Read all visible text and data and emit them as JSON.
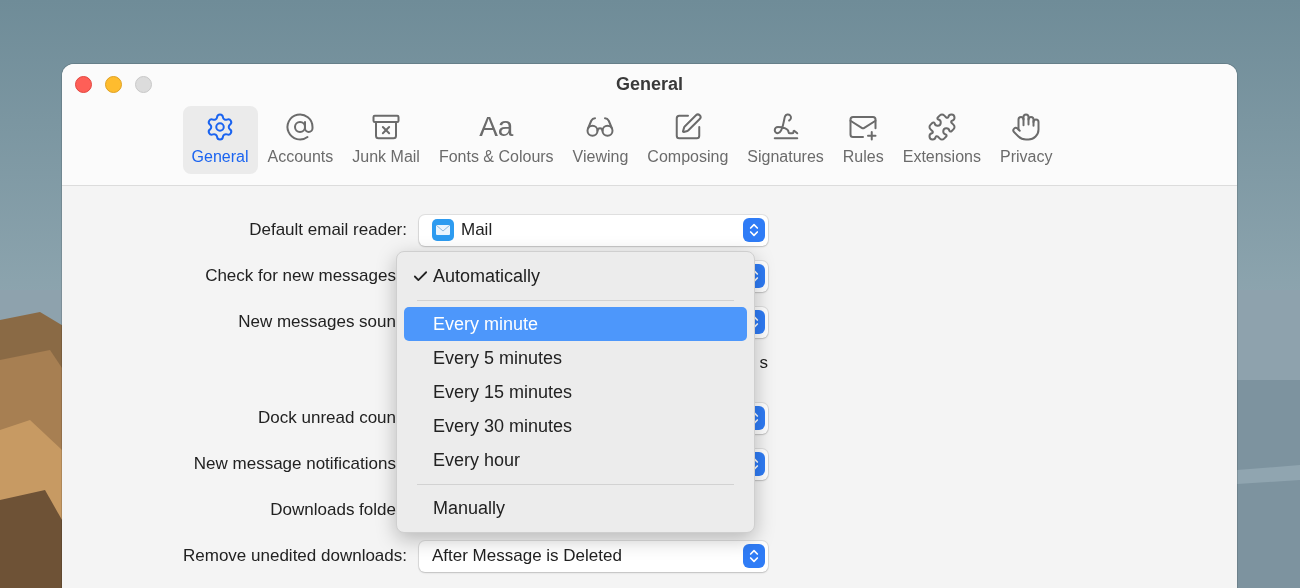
{
  "window": {
    "title": "General"
  },
  "toolbar": [
    {
      "label": "General",
      "selected": true
    },
    {
      "label": "Accounts",
      "selected": false
    },
    {
      "label": "Junk Mail",
      "selected": false
    },
    {
      "label": "Fonts & Colours",
      "glyph": "Aa",
      "selected": false
    },
    {
      "label": "Viewing",
      "selected": false
    },
    {
      "label": "Composing",
      "selected": false
    },
    {
      "label": "Signatures",
      "selected": false
    },
    {
      "label": "Rules",
      "selected": false
    },
    {
      "label": "Extensions",
      "selected": false
    },
    {
      "label": "Privacy",
      "selected": false
    }
  ],
  "rows": [
    {
      "kind": "app_select",
      "label": "Default email reader:",
      "value": "Mail"
    },
    {
      "kind": "covered_select",
      "label": "Check for new messages"
    },
    {
      "kind": "covered_select",
      "label": "New messages soun"
    },
    {
      "kind": "fragment",
      "text": "s"
    },
    {
      "kind": "covered_select",
      "label": "Dock unread coun"
    },
    {
      "kind": "covered_select",
      "label": "New message notifications"
    },
    {
      "kind": "covered",
      "label": "Downloads folde"
    },
    {
      "kind": "select",
      "label": "Remove unedited downloads:",
      "value": "After Message is Deleted"
    }
  ],
  "menu": [
    {
      "kind": "item",
      "label": "Automatically",
      "checked": true,
      "selected": false
    },
    {
      "kind": "separator"
    },
    {
      "kind": "item",
      "label": "Every minute",
      "checked": false,
      "selected": true
    },
    {
      "kind": "item",
      "label": "Every 5 minutes",
      "checked": false,
      "selected": false
    },
    {
      "kind": "item",
      "label": "Every 15 minutes",
      "checked": false,
      "selected": false
    },
    {
      "kind": "item",
      "label": "Every 30 minutes",
      "checked": false,
      "selected": false
    },
    {
      "kind": "item",
      "label": "Every hour",
      "checked": false,
      "selected": false
    },
    {
      "kind": "separator"
    },
    {
      "kind": "item",
      "label": "Manually",
      "checked": false,
      "selected": false
    }
  ]
}
